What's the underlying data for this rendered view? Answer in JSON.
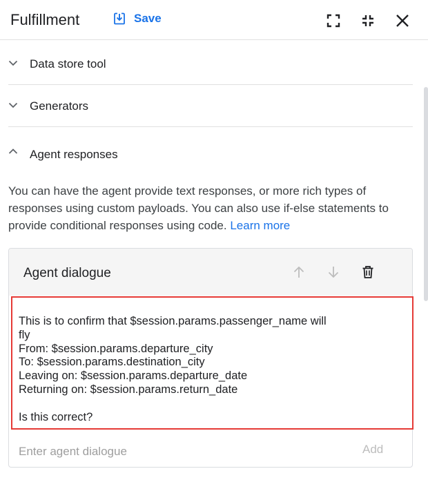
{
  "header": {
    "title": "Fulfillment",
    "save_label": "Save",
    "icons": [
      "save-icon",
      "fullscreen-icon",
      "exit-fullscreen-icon",
      "close-icon"
    ]
  },
  "sections": [
    {
      "label": "Data store tool",
      "expanded": false
    },
    {
      "label": "Generators",
      "expanded": false
    },
    {
      "label": "Agent responses",
      "expanded": true
    }
  ],
  "agent_responses": {
    "description": "You can have the agent provide text responses, or more rich types of responses using custom payloads. You can also use if-else statements to provide conditional responses using code.",
    "learn_more": "Learn more"
  },
  "agent_dialogue": {
    "title": "Agent dialogue",
    "icons": [
      "arrow-up-icon",
      "arrow-down-icon",
      "delete-icon"
    ],
    "text": "This is to confirm that $session.params.passenger_name will\nfly\nFrom: $session.params.departure_city\nTo: $session.params.destination_city\nLeaving on: $session.params.departure_date\nReturning on: $session.params.return_date\n\nIs this correct?",
    "input_placeholder": "Enter agent dialogue",
    "input_value": "",
    "add_label": "Add"
  },
  "colors": {
    "accent": "#1a73e8",
    "highlight_border": "#e53935",
    "card_header_bg": "#f5f5f5"
  }
}
